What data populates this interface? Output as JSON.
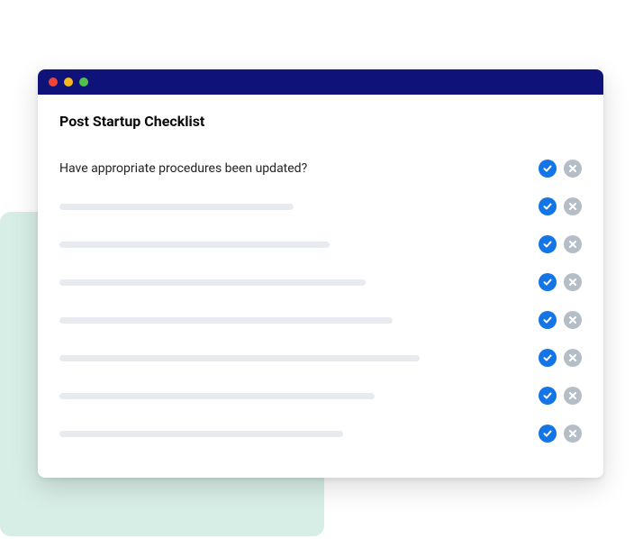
{
  "window": {
    "title": "Post Startup Checklist"
  },
  "checklist": {
    "items": [
      {
        "text": "Have appropriate procedures been updated?",
        "placeholderWidth": 0
      },
      {
        "text": "",
        "placeholderWidth": 260
      },
      {
        "text": "",
        "placeholderWidth": 300
      },
      {
        "text": "",
        "placeholderWidth": 340
      },
      {
        "text": "",
        "placeholderWidth": 370
      },
      {
        "text": "",
        "placeholderWidth": 400
      },
      {
        "text": "",
        "placeholderWidth": 350
      },
      {
        "text": "",
        "placeholderWidth": 315
      }
    ]
  },
  "colors": {
    "accent": "#1476e6",
    "muted": "#b5bec7",
    "titlebar": "#0f1278",
    "bgShape": "#d6eee6"
  }
}
